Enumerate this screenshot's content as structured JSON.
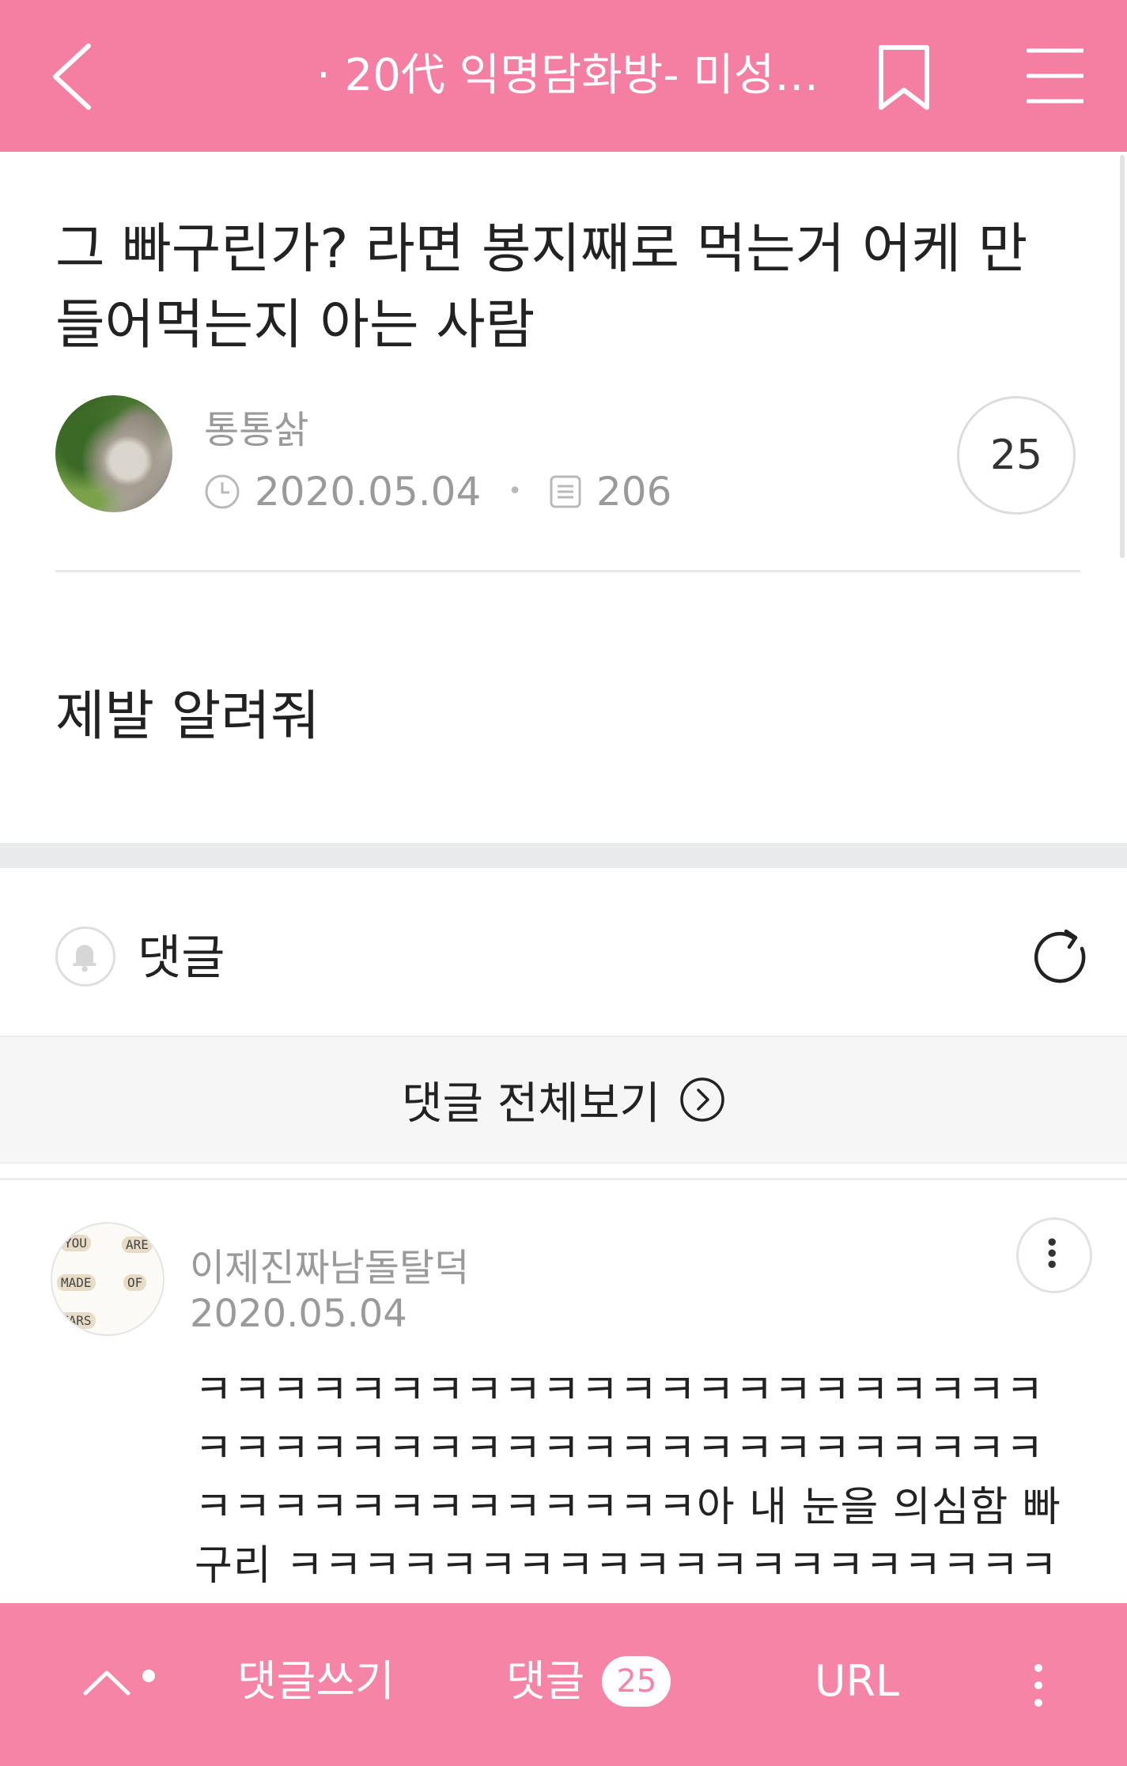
{
  "header": {
    "title": "· 20代 익명담화방- 미성…",
    "back_icon": "chevron-left-icon",
    "bookmark_icon": "bookmark-icon",
    "menu_icon": "hamburger-menu-icon"
  },
  "post": {
    "title": "그 빠구린가? 라면 봉지째로 먹는거 어케 만들어먹는지 아는 사람",
    "author": "통통삵",
    "date": "2020.05.04",
    "views": "206",
    "comment_count": "25",
    "body": "제발 알려줘"
  },
  "comments_section": {
    "header": "댓글",
    "view_all_label": "댓글 전체보기"
  },
  "comment": {
    "author": "이제진짜남돌탈덕",
    "date": "2020.05.04",
    "text": "ㅋㅋㅋㅋㅋㅋㅋㅋㅋㅋㅋㅋㅋㅋㅋㅋㅋㅋㅋㅋㅋㅋㅋㅋㅋㅋㅋㅋㅋㅋㅋㅋㅋㅋㅋㅋㅋㅋㅋㅋㅋㅋㅋㅋㅋㅋㅋㅋㅋㅋㅋㅋㅋㅋㅋㅋㅋ아 내 눈을 의심함 빠구리 ㅋㅋㅋㅋㅋㅋㅋㅋㅋㅋㅋㅋㅋㅋㅋㅋㅋㅋㅋㅋㅋㅋㅋㅋㅋ",
    "avatar_words": [
      "YOU",
      "ARE",
      "MADE",
      "OF",
      "TARS"
    ]
  },
  "bottom_bar": {
    "write_label": "댓글쓰기",
    "comments_label": "댓글",
    "comments_badge": "25",
    "url_label": "URL"
  },
  "colors": {
    "accent": "#f47fa2",
    "bottom_bar": "#f584a6",
    "meta_text": "#9a9a9a"
  }
}
